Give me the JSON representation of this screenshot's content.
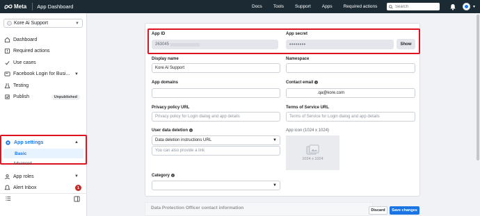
{
  "topbar": {
    "brand": "Meta",
    "app_title": "App Dashboard",
    "nav": [
      "Docs",
      "Tools",
      "Support",
      "Apps",
      "Required actions"
    ],
    "search_placeholder": "Search"
  },
  "sidebar": {
    "app_name": "Kore Ai Support",
    "items": [
      {
        "label": "Dashboard",
        "icon": "dashboard-icon"
      },
      {
        "label": "Required actions",
        "icon": "required-actions-icon"
      },
      {
        "label": "Use cases",
        "icon": "use-cases-icon"
      },
      {
        "label": "Facebook Login for Busi...",
        "icon": "facebook-login-icon"
      },
      {
        "label": "Testing",
        "icon": "testing-icon"
      },
      {
        "label": "Publish",
        "icon": "publish-icon",
        "badge": "Unpublished"
      }
    ],
    "app_settings": {
      "label": "App settings",
      "sub_selected": "Basic",
      "sub_other": "Advanced"
    },
    "lower_items": [
      {
        "label": "App roles",
        "icon": "app-roles-icon"
      },
      {
        "label": "Alert Inbox",
        "icon": "alert-inbox-icon",
        "badge": "1"
      }
    ]
  },
  "form": {
    "app_id": {
      "label": "App ID",
      "value": "263045"
    },
    "app_secret": {
      "label": "App secret",
      "value": "••••••••",
      "show_label": "Show"
    },
    "display_name": {
      "label": "Display name",
      "value": "Kore Ai Support"
    },
    "namespace": {
      "label": "Namespace",
      "value": ""
    },
    "app_domains": {
      "label": "App domains",
      "value": ""
    },
    "contact_email": {
      "label": "Contact email",
      "value": ".qa@kore.com"
    },
    "privacy_url": {
      "label": "Privacy policy URL",
      "placeholder": "Privacy policy for Login dialog and app details"
    },
    "tos_url": {
      "label": "Terms of Service URL",
      "placeholder": "Terms of Service for Login dialog and app details"
    },
    "user_data_deletion": {
      "label": "User data deletion",
      "selected": "Data deletion instructions URL",
      "placeholder": "You can also provide a link"
    },
    "app_icon": {
      "label": "App icon (1024 x 1024)",
      "size_text": "1024 x 1024"
    },
    "category": {
      "label": "Category",
      "selected": ""
    }
  },
  "footer": {
    "section_title": "Data Protection Officer contact information",
    "discard_label": "Discard",
    "save_label": "Save changes"
  },
  "colors": {
    "accent": "#1877f2",
    "highlight": "#e0121f",
    "topbar": "#1c2b33"
  }
}
